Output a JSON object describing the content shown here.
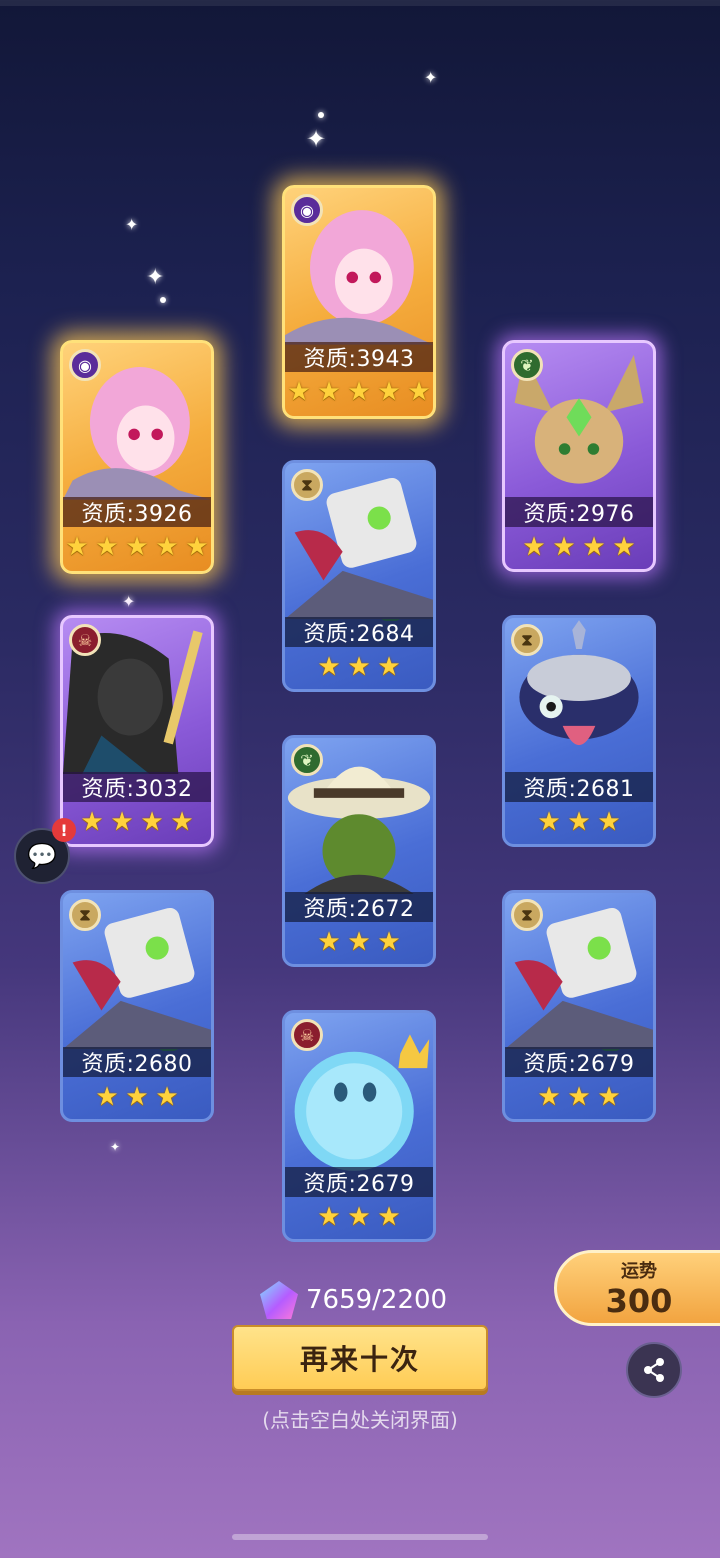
{
  "cards": [
    {
      "id": "c1",
      "rarity": 5,
      "element": "arcane-eye",
      "quality": "资质:3926",
      "stars": 5
    },
    {
      "id": "c2",
      "rarity": 5,
      "element": "arcane-eye",
      "quality": "资质:3943",
      "stars": 5
    },
    {
      "id": "c3",
      "rarity": 4,
      "element": "nature-leaf",
      "quality": "资质:2976",
      "stars": 4
    },
    {
      "id": "c4",
      "rarity": 4,
      "element": "fire-skull",
      "quality": "资质:3032",
      "stars": 4
    },
    {
      "id": "c5",
      "rarity": 3,
      "element": "neutral-hourglass",
      "quality": "资质:2684",
      "stars": 3
    },
    {
      "id": "c6",
      "rarity": 3,
      "element": "neutral-hourglass",
      "quality": "资质:2681",
      "stars": 3
    },
    {
      "id": "c7",
      "rarity": 3,
      "element": "nature-leaf",
      "quality": "资质:2672",
      "stars": 3
    },
    {
      "id": "c8",
      "rarity": 3,
      "element": "neutral-hourglass",
      "quality": "资质:2680",
      "stars": 3
    },
    {
      "id": "c9",
      "rarity": 3,
      "element": "neutral-hourglass",
      "quality": "资质:2679",
      "stars": 3
    },
    {
      "id": "c10",
      "rarity": 3,
      "element": "fire-skull",
      "quality": "资质:2679",
      "stars": 3
    }
  ],
  "currency": {
    "value": "7659/2200",
    "icon": "star-crystal-icon"
  },
  "retry_button": {
    "label": "再来十次"
  },
  "hint": "(点击空白处关闭界面)",
  "fortune": {
    "label": "运势",
    "value": "300"
  },
  "share_icon": "share-icon",
  "chat_icon": "chat-icon",
  "chat_badge": "!",
  "colors": {
    "gold_card": "#f5ad3e",
    "purple_card": "#8a5ad8",
    "blue_card": "#4a6ed6",
    "button": "#ffcc55",
    "star": "#ffd23c"
  }
}
